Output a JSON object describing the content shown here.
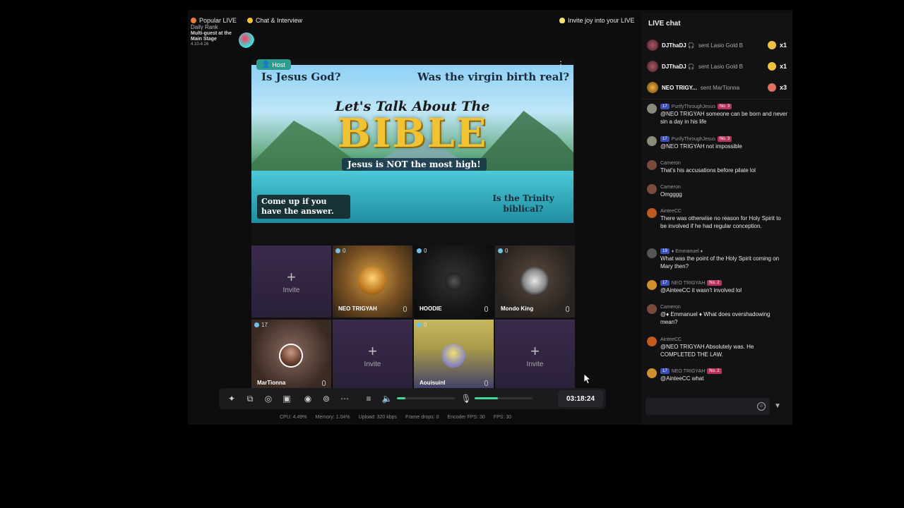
{
  "top": {
    "popular_label": "Popular LIVE",
    "popular_sub": "Daily Rank",
    "chat_interview_label": "Chat & Interview",
    "invite_joy_label": "Invite joy into your LIVE",
    "stage_title": "Multi-guest at the Main Stage",
    "stage_dates": "4.10-4.26"
  },
  "canvas": {
    "host_label": "Host",
    "more_glyph": "⋮",
    "banner": {
      "q1": "Is Jesus God?",
      "q2": "Was the virgin birth real?",
      "lets_talk": "Let's Talk About The",
      "bible": "BIBLE",
      "subtitle": "Jesus is NOT the most high!",
      "come_up": "Come up if you have the answer.",
      "trinity": "Is the Trinity biblical?"
    }
  },
  "guests": [
    {
      "type": "invite",
      "plus": "+",
      "label": "Invite"
    },
    {
      "type": "guest",
      "count": "0",
      "name": "NEO TRIGYAH"
    },
    {
      "type": "guest",
      "count": "0",
      "name": "HOODIE"
    },
    {
      "type": "guest",
      "count": "0",
      "name": "Mondo King"
    },
    {
      "type": "guest",
      "count": "17",
      "name": "MarTionna"
    },
    {
      "type": "invite",
      "plus": "+",
      "label": "Invite"
    },
    {
      "type": "guest",
      "count": "0",
      "name": "Aouisuinl"
    },
    {
      "type": "invite",
      "plus": "+",
      "label": "Invite"
    }
  ],
  "controls": {
    "icons": [
      "magic-wand",
      "layout",
      "ai-effects",
      "add-source",
      "record",
      "camera",
      "more",
      "settings",
      "volume",
      "microphone"
    ],
    "volume_level": 0.15,
    "mic_level": 0.4,
    "timer": "03:18:24"
  },
  "stats": {
    "cpu": "CPU: 4.49%",
    "memory": "Memory: 1.04%",
    "upload": "Upload: 320 kbps",
    "frame_drops": "Frame drops: 0",
    "encoder_fps": "Encoder FPS: 30",
    "fps": "FPS: 30"
  },
  "chat": {
    "title": "LIVE chat",
    "gifts": [
      {
        "user": "DJThaDJ 🎧",
        "sent": "sent Lasio Gold B",
        "mult": "x1"
      },
      {
        "user": "DJThaDJ 🎧",
        "sent": "sent Lasio Gold B",
        "mult": "x1"
      },
      {
        "user": "NEO TRIGY...",
        "sent": "sent MarTionna",
        "mult": "x3"
      }
    ],
    "messages": [
      {
        "level": "17",
        "user": "PurifyThroughJesus",
        "rank": "No. 3",
        "text": "@NEO TRIGYAH someone can be born and never sin a day in his life"
      },
      {
        "level": "17",
        "user": "PurifyThroughJesus",
        "rank": "No. 3",
        "text": "@NEO TRIGYAH not impossible"
      },
      {
        "level": "",
        "user": "Cameron",
        "rank": "",
        "text": "That's his accusations before pilate lol"
      },
      {
        "level": "",
        "user": "Cameron",
        "rank": "",
        "text": "Omgggg"
      },
      {
        "level": "",
        "user": "AinteeCC",
        "rank": "",
        "text": "There was otherwise no reason for Holy Spirit to be involved if he had regular conception."
      },
      {
        "level": "19",
        "user": "♦ Emmanuel ♦",
        "rank": "",
        "text": "What was the point of the Holy Spirit coming on Mary then?"
      },
      {
        "level": "17",
        "user": "NEO TRIGYAH",
        "rank": "No. 2",
        "text": "@AinteeCC it wasn't involved lol"
      },
      {
        "level": "",
        "user": "Cameron",
        "rank": "",
        "text": "@♦ Emmanuel ♦ What does overshadowing mean?"
      },
      {
        "level": "",
        "user": "AinteeCC",
        "rank": "",
        "text": "@NEO TRIGYAH Absolutely was. He COMPLETED THE LAW."
      },
      {
        "level": "17",
        "user": "NEO TRIGYAH",
        "rank": "No. 2",
        "text": "@AinteeCC what"
      }
    ],
    "input_placeholder": ""
  }
}
